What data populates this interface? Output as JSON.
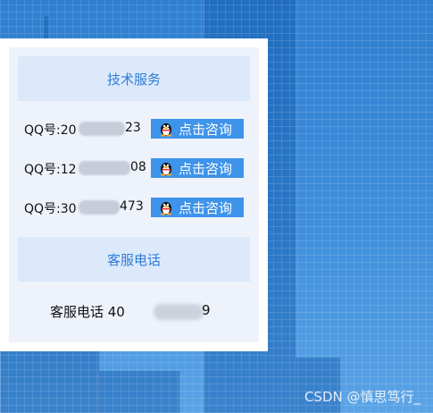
{
  "sections": {
    "tech_service": {
      "title": "技术服务"
    },
    "customer_phone": {
      "title": "客服电话"
    }
  },
  "qq_contacts": [
    {
      "prefix": "QQ号:20",
      "suffix": "23",
      "button_label": "点击咨询"
    },
    {
      "prefix": "QQ号:12",
      "suffix": "08",
      "button_label": "点击咨询"
    },
    {
      "prefix": "QQ号:30",
      "suffix": "473",
      "button_label": "点击咨询"
    }
  ],
  "phone": {
    "prefix": "客服电话 40",
    "suffix": "9"
  },
  "watermark": "CSDN @慎思笃行_",
  "colors": {
    "accent_button": "#3e93ea",
    "header_bg": "#dbe9fb",
    "header_text": "#2f7cd6",
    "panel_bg": "#eef3fb"
  },
  "icons": {
    "consult_button_icon": "qq-penguin-icon"
  }
}
